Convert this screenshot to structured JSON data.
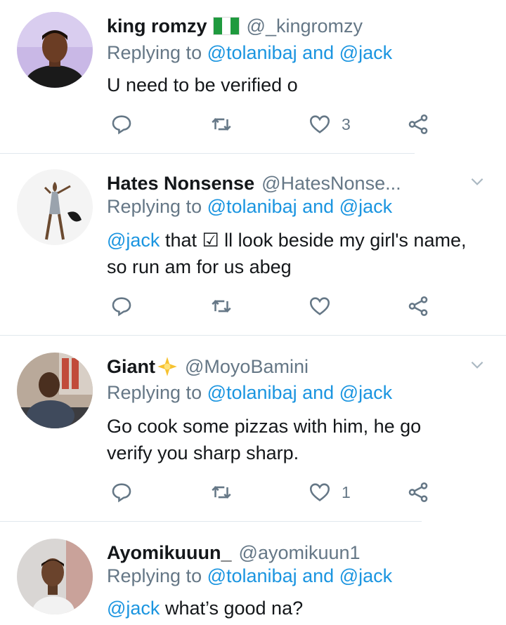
{
  "tweets": [
    {
      "name": "king romzy",
      "name_badge": "nigeria-flag",
      "handle": "@_kingromzy",
      "replying_prefix": "Replying to ",
      "replying_user1": "@tolanibaj",
      "replying_and": " and ",
      "replying_user2": "@jack",
      "body_mention": "",
      "body_text": "U need to be verified o",
      "reply_icon": "reply-icon",
      "retweet_icon": "retweet-icon",
      "like_icon": "heart-icon",
      "like_count": "3",
      "share_icon": "share-icon"
    },
    {
      "name": "Hates Nonsense",
      "handle": "@HatesNonse...",
      "replying_prefix": "Replying to ",
      "replying_user1": "@tolanibaj",
      "replying_and": " and ",
      "replying_user2": "@jack",
      "body_mention": "@jack",
      "body_text": " that ☑ ll look beside my girl's name, so run am for us abeg",
      "like_count": ""
    },
    {
      "name": "Giant",
      "name_badge": "star-emoji",
      "handle": "@MoyoBamini",
      "replying_prefix": "Replying to ",
      "replying_user1": "@tolanibaj",
      "replying_and": " and ",
      "replying_user2": "@jack",
      "body_mention": "",
      "body_text": "Go cook some pizzas with him, he go verify you sharp sharp.",
      "like_count": "1"
    },
    {
      "name": "Ayomikuuun_",
      "handle": "@ayomikuun1",
      "replying_prefix": "Replying to ",
      "replying_user1": "@tolanibaj",
      "replying_and": " and ",
      "replying_user2": "@jack",
      "body_mention": "@jack",
      "body_text": " what’s good na?"
    }
  ],
  "colors": {
    "link": "#1b95e0",
    "muted": "#657786",
    "text": "#14171a",
    "divider": "#e1e8ed"
  }
}
